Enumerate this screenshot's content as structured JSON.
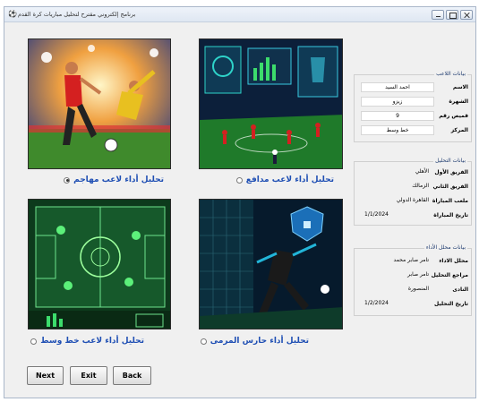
{
  "window": {
    "title": "برنامج إلكتروني مقترح لتحليل مباريات كرة القدم"
  },
  "analysis_options": [
    {
      "label": "تحليل أداء لاعب مهاجم",
      "checked": true
    },
    {
      "label": "تحليل أداء لاعب مدافع",
      "checked": false
    },
    {
      "label": "تحليل أداء لاعب خط وسط",
      "checked": false
    },
    {
      "label": "تحليل أداء حارس المرمى",
      "checked": false
    }
  ],
  "player_group": {
    "title": "بيانات اللاعب",
    "fields": [
      {
        "label": "الاسم",
        "value": "احمد السيد"
      },
      {
        "label": "الشهرة",
        "value": "زيزو"
      },
      {
        "label": "قميص رقم",
        "value": "9"
      },
      {
        "label": "المركز",
        "value": "خط وسط"
      }
    ]
  },
  "match_group": {
    "title": "بيانات التحليل",
    "fields": [
      {
        "label": "الفريق الأول",
        "value": "الأهلي"
      },
      {
        "label": "الفريق الثاني",
        "value": "الزمالك"
      },
      {
        "label": "ملعب المباراة",
        "value": "القاهرة الدولي"
      },
      {
        "label": "تاريخ المباراة",
        "value": "1/1/2024"
      }
    ]
  },
  "analyst_group": {
    "title": "بيانات محلل الأداء",
    "fields": [
      {
        "label": "محلل الاداء",
        "value": "تامر صابر محمد"
      },
      {
        "label": "مراجع التحليل",
        "value": "تامر صابر"
      },
      {
        "label": "النادى",
        "value": "المنصورة"
      },
      {
        "label": "تاريخ التحليل",
        "value": "1/2/2024"
      }
    ]
  },
  "buttons": {
    "next": "Next",
    "exit": "Exit",
    "back": "Back"
  },
  "colors": {
    "option_label": "#1f4fb4",
    "title_bar": "#dfe7f2"
  }
}
